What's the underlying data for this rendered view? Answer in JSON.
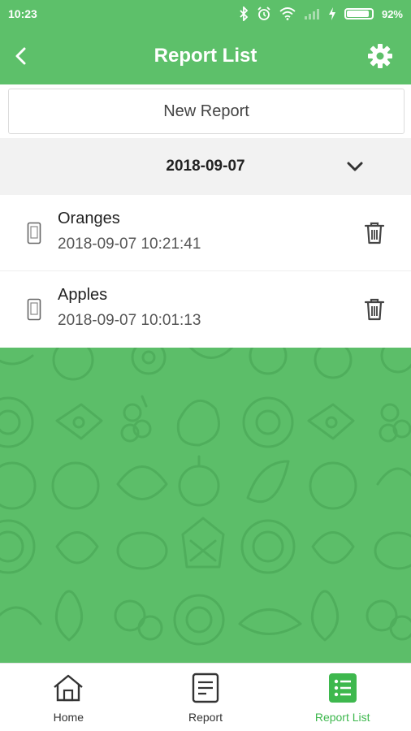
{
  "status_bar": {
    "time": "10:23",
    "battery_percent": "92%",
    "battery_level": 0.92,
    "icons": [
      "bluetooth-icon",
      "alarm-icon",
      "wifi-icon",
      "signal-icon",
      "charging-icon",
      "battery-icon"
    ]
  },
  "header": {
    "title": "Report List",
    "back_icon": "chevron-left-icon",
    "settings_icon": "gear-icon"
  },
  "actions": {
    "new_report_label": "New Report"
  },
  "date_group": {
    "date": "2018-09-07",
    "expand_icon": "chevron-down-icon"
  },
  "reports": [
    {
      "name": "Oranges",
      "timestamp": "2018-09-07 10:21:41",
      "device_icon": "phone-icon",
      "delete_icon": "trash-icon"
    },
    {
      "name": "Apples",
      "timestamp": "2018-09-07 10:01:13",
      "device_icon": "phone-icon",
      "delete_icon": "trash-icon"
    }
  ],
  "bottom_nav": {
    "items": [
      {
        "label": "Home",
        "icon": "home-icon",
        "active": false
      },
      {
        "label": "Report",
        "icon": "document-icon",
        "active": false
      },
      {
        "label": "Report List",
        "icon": "list-icon",
        "active": true
      }
    ]
  },
  "colors": {
    "primary": "#5dc06a",
    "active_nav": "#3eb84e",
    "date_bar": "#f2f2f2"
  }
}
